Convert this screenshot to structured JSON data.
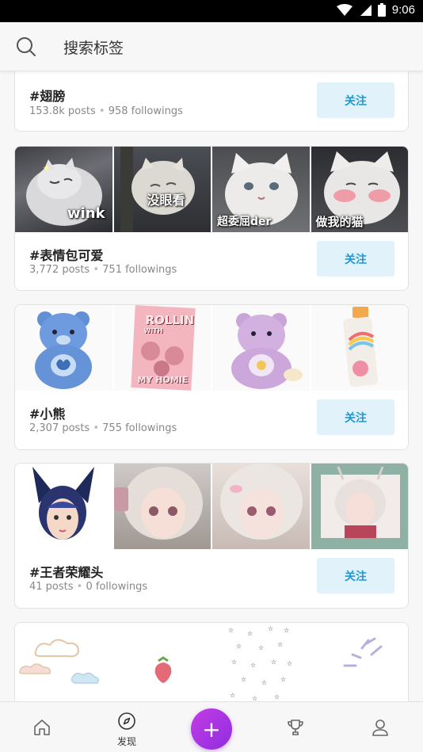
{
  "status_bar": {
    "time": "9:06"
  },
  "search": {
    "placeholder": "搜索标签"
  },
  "cards": [
    {
      "title": "#翅膀",
      "posts": "153.8k posts",
      "followings": "958 followings",
      "follow_label": "关注"
    },
    {
      "title": "#表情包可爱",
      "posts": "3,772 posts",
      "followings": "751 followings",
      "follow_label": "关注",
      "captions": [
        "wink",
        "没眼看",
        "超委屈der",
        "做我的猫"
      ]
    },
    {
      "title": "#小熊",
      "posts": "2,307 posts",
      "followings": "755 followings",
      "follow_label": "关注",
      "captions": [
        "ROLLIN",
        "WITH",
        "MY HOMIE"
      ]
    },
    {
      "title": "#王者荣耀头",
      "posts": "41 posts",
      "followings": "0 followings",
      "follow_label": "关注"
    },
    {
      "title": "",
      "posts": "",
      "followings": ""
    }
  ],
  "separator": "•",
  "bottom_nav": {
    "items": [
      {
        "icon": "home-icon",
        "label": ""
      },
      {
        "icon": "compass-icon",
        "label": "发现"
      },
      {
        "icon": "plus-icon",
        "label": "+"
      },
      {
        "icon": "trophy-icon",
        "label": ""
      },
      {
        "icon": "profile-icon",
        "label": ""
      }
    ]
  },
  "colors": {
    "accent": "#1b9ad6",
    "follow_bg": "#e2f2fb",
    "fab_start": "#c43ae6",
    "fab_end": "#8e2fe0"
  }
}
